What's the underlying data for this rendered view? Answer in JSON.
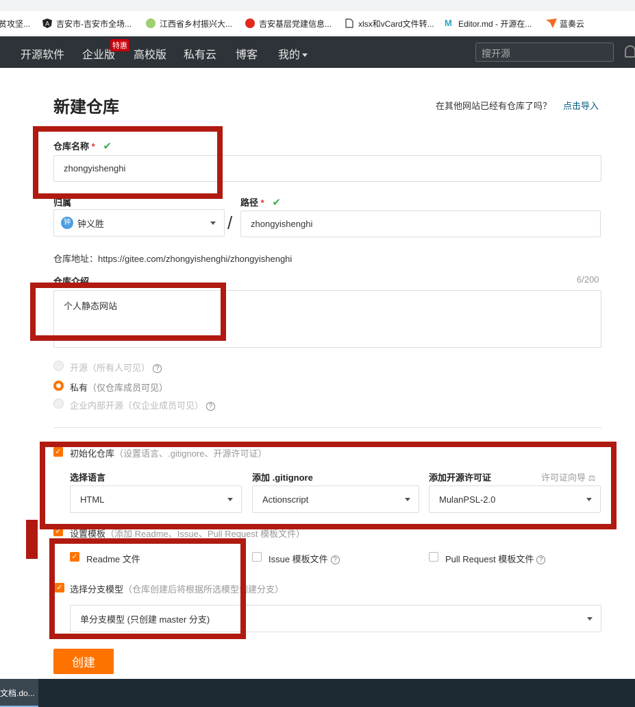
{
  "bookmarks": [
    {
      "label": "贫攻坚...",
      "icon": "blank-icon"
    },
    {
      "label": "吉安市-吉安市全场...",
      "icon": "angular-logo-icon"
    },
    {
      "label": "江西省乡村振兴大...",
      "icon": "leaf-logo-icon"
    },
    {
      "label": "吉安基层党建信息...",
      "icon": "party-emblem-icon"
    },
    {
      "label": "xlsx和vCard文件转...",
      "icon": "document-icon"
    },
    {
      "label": "Editor.md - 开源在...",
      "icon": "editor-md-logo-icon"
    },
    {
      "label": "蓝奏云",
      "icon": "lanzou-logo-icon"
    }
  ],
  "nav": {
    "items": [
      "开源软件",
      "企业版",
      "高校版",
      "私有云",
      "博客",
      "我的"
    ],
    "badge": "特惠",
    "search_placeholder": "搜开源"
  },
  "page": {
    "title": "新建仓库",
    "import_question": "在其他网站已经有仓库了吗？",
    "import_link": "点击导入"
  },
  "form": {
    "repo_name_label": "仓库名称",
    "required_mark": "*",
    "repo_name_value": "zhongyishenghi",
    "owner_label": "归属",
    "owner_avatar_char": "钟",
    "owner_value": "钟义胜",
    "slash": "/",
    "path_label": "路径",
    "path_value": "zhongyishenghi",
    "address_text": "仓库地址：https://gitee.com/zhongyishenghi/zhongyishenghi",
    "intro_label": "仓库介绍",
    "intro_counter": "6/200",
    "intro_value": "个人静态网站",
    "visibility": [
      {
        "label": "开源",
        "note": "（所有人可见）",
        "selected": false,
        "disabled": true,
        "help": true
      },
      {
        "label": "私有",
        "note": "（仅仓库成员可见）",
        "selected": true,
        "disabled": false,
        "help": false
      },
      {
        "label": "企业内部开源",
        "note": "（仅企业成员可见）",
        "selected": false,
        "disabled": true,
        "help": true
      }
    ],
    "init_label": "初始化仓库",
    "init_note": "（设置语言、.gitignore、开源许可证）",
    "language_label": "选择语言",
    "language_value": "HTML",
    "gitignore_label": "添加 .gitignore",
    "gitignore_value": "Actionscript",
    "license_label": "添加开源许可证",
    "license_guide": "许可证向导",
    "license_value": "MulanPSL-2.0",
    "template_label": "设置模板",
    "template_note": "（添加 Readme、Issue、Pull Request 模板文件）",
    "readme_label": "Readme 文件",
    "issue_label": "Issue 模板文件",
    "pr_label": "Pull Request 模板文件",
    "branch_label": "选择分支模型",
    "branch_note": "（仓库创建后将根据所选模型创建分支）",
    "branch_value": "单分支模型 (只创建 master 分支)",
    "help_glyph": "?",
    "check_glyph": "✔",
    "checkbox_glyph": "✓",
    "submit_label": "创建"
  },
  "taskbar": {
    "item": "文档.do..."
  },
  "colors": {
    "accent": "#fe7300",
    "nav_bg": "#2d3338",
    "annotation": "#b01a10",
    "link": "#005980"
  }
}
